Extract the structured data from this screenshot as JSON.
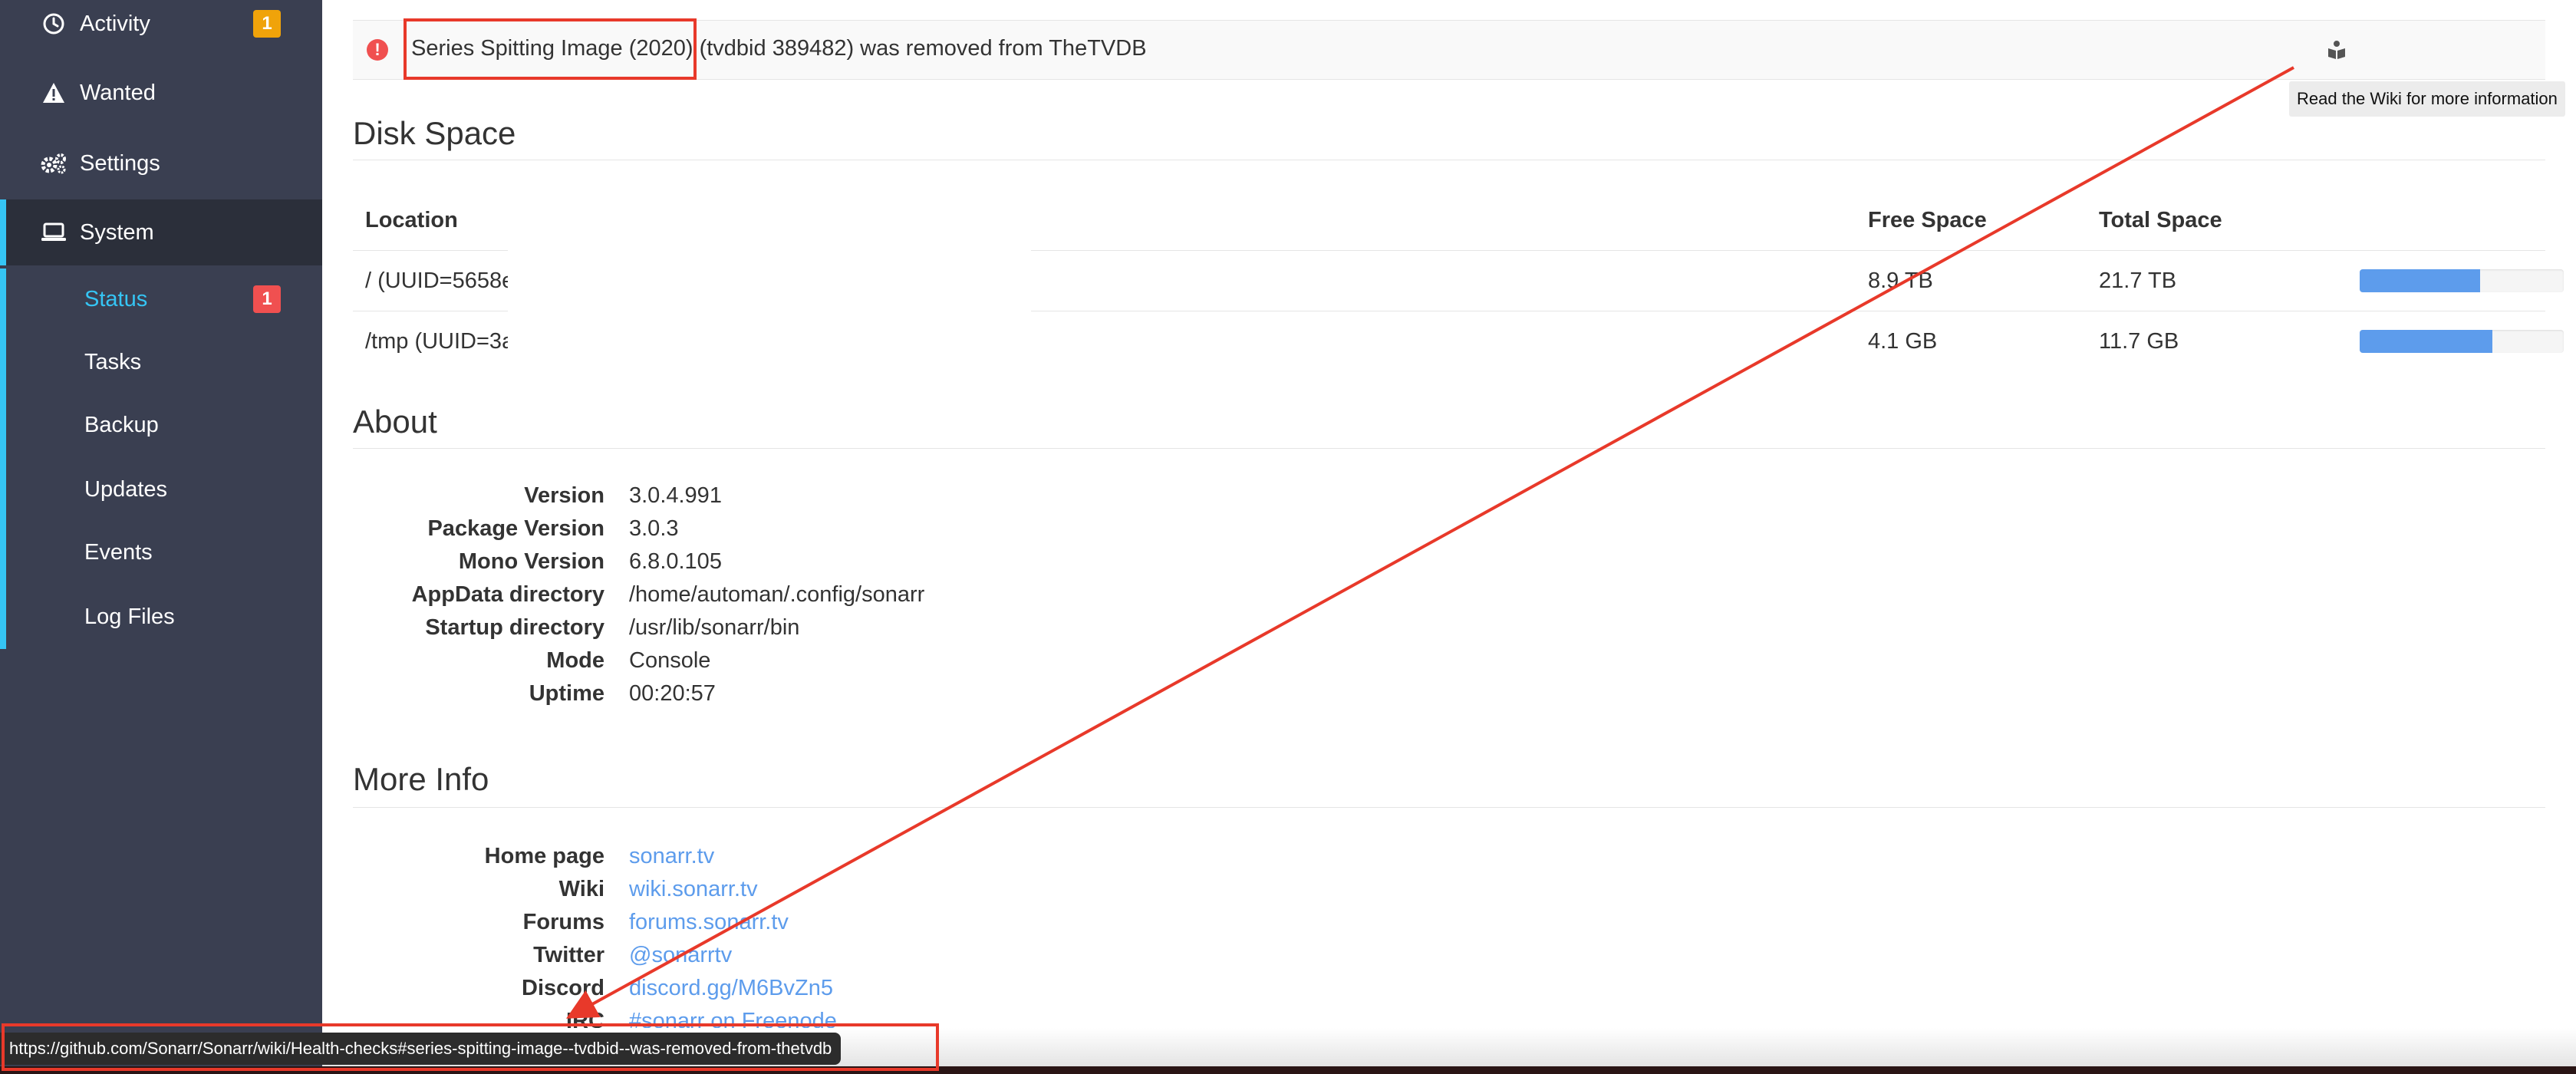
{
  "sidebar": {
    "items": [
      {
        "label": "Activity",
        "icon": "clock-icon",
        "badge": "1",
        "badge_color": "#f0a30a"
      },
      {
        "label": "Wanted",
        "icon": "warning-icon"
      },
      {
        "label": "Settings",
        "icon": "gears-icon"
      },
      {
        "label": "System",
        "icon": "laptop-icon",
        "active": true
      }
    ],
    "subitems": [
      {
        "label": "Status",
        "active": true,
        "badge": "1",
        "badge_color": "#f05050"
      },
      {
        "label": "Tasks"
      },
      {
        "label": "Backup"
      },
      {
        "label": "Updates"
      },
      {
        "label": "Events"
      },
      {
        "label": "Log Files"
      }
    ],
    "accent_color": "#35c5f4",
    "background_color": "#3a3f51"
  },
  "health": {
    "message_highlighted": "Series Spitting Image (2020)",
    "message_rest": " (tvdbid 389482) was removed from TheTVDB",
    "icon": "exclamation-circle-icon",
    "action_icon": "book-reader-icon",
    "tooltip": "Read the Wiki for more information"
  },
  "disk_space": {
    "title": "Disk Space",
    "columns": [
      "Location",
      "Free Space",
      "Total Space"
    ],
    "rows": [
      {
        "location": "/ (UUID=5658e",
        "free": "8.9 TB",
        "total": "21.7 TB",
        "used_fraction": 0.59
      },
      {
        "location": "/tmp (UUID=3a",
        "free": "4.1 GB",
        "total": "11.7 GB",
        "used_fraction": 0.65
      }
    ]
  },
  "about": {
    "title": "About",
    "rows": [
      {
        "key": "Version",
        "value": "3.0.4.991"
      },
      {
        "key": "Package Version",
        "value": "3.0.3"
      },
      {
        "key": "Mono Version",
        "value": "6.8.0.105"
      },
      {
        "key": "AppData directory",
        "value": "/home/automan/.config/sonarr"
      },
      {
        "key": "Startup directory",
        "value": "/usr/lib/sonarr/bin"
      },
      {
        "key": "Mode",
        "value": "Console"
      },
      {
        "key": "Uptime",
        "value": "00:20:57"
      }
    ]
  },
  "more_info": {
    "title": "More Info",
    "rows": [
      {
        "key": "Home page",
        "value": "sonarr.tv"
      },
      {
        "key": "Wiki",
        "value": "wiki.sonarr.tv"
      },
      {
        "key": "Forums",
        "value": "forums.sonarr.tv"
      },
      {
        "key": "Twitter",
        "value": "@sonarrtv"
      },
      {
        "key": "Discord",
        "value": "discord.gg/M6BvZn5"
      },
      {
        "key": "IRC",
        "value": "#sonarr on Freenode"
      }
    ]
  },
  "status_bar": {
    "url": "https://github.com/Sonarr/Sonarr/wiki/Health-checks#series-spitting-image--tvdbid--was-removed-from-thetvdb"
  },
  "colors": {
    "link": "#5d9cec",
    "progress": "#5d9cec",
    "annotation": "#e8392a"
  }
}
